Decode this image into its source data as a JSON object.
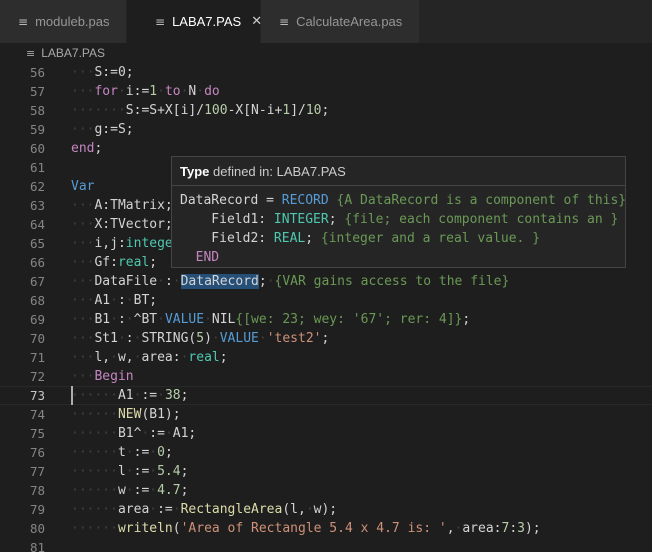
{
  "tabs": [
    {
      "label": "moduleb.pas",
      "active": false
    },
    {
      "label": "LABA7.PAS",
      "active": true
    },
    {
      "label": "CalculateArea.pas",
      "active": false
    }
  ],
  "breadcrumb": "LABA7.PAS",
  "lines": [
    {
      "n": 56,
      "segs": [
        [
          "ws",
          "···"
        ],
        [
          "",
          "S:=0;"
        ]
      ]
    },
    {
      "n": 57,
      "segs": [
        [
          "ws",
          "···"
        ],
        [
          "kw",
          "for"
        ],
        [
          "ws",
          "·"
        ],
        [
          "",
          "i:="
        ],
        [
          "nm",
          "1"
        ],
        [
          "ws",
          "·"
        ],
        [
          "kw",
          "to"
        ],
        [
          "ws",
          "·"
        ],
        [
          "",
          "N"
        ],
        [
          "ws",
          "·"
        ],
        [
          "kw",
          "do"
        ]
      ]
    },
    {
      "n": 58,
      "segs": [
        [
          "ws",
          "·······"
        ],
        [
          "",
          "S:=S+X[i]/"
        ],
        [
          "nm",
          "100"
        ],
        [
          "",
          "-X[N-i+"
        ],
        [
          "nm",
          "1"
        ],
        [
          "",
          "]/"
        ],
        [
          "nm",
          "10"
        ],
        [
          "",
          ";"
        ]
      ]
    },
    {
      "n": 59,
      "segs": [
        [
          "ws",
          "···"
        ],
        [
          "",
          "g:=S;"
        ]
      ]
    },
    {
      "n": 60,
      "segs": [
        [
          "kw",
          "end"
        ],
        [
          "",
          ";"
        ]
      ]
    },
    {
      "n": 61,
      "segs": []
    },
    {
      "n": 62,
      "segs": [
        [
          "kb",
          "Var"
        ]
      ]
    },
    {
      "n": 63,
      "segs": [
        [
          "ws",
          "···"
        ],
        [
          "",
          "A:TMatrix;"
        ]
      ]
    },
    {
      "n": 64,
      "segs": [
        [
          "ws",
          "···"
        ],
        [
          "",
          "X:TVector;"
        ]
      ]
    },
    {
      "n": 65,
      "segs": [
        [
          "ws",
          "···"
        ],
        [
          "",
          "i,j:"
        ],
        [
          "tp",
          "integer"
        ]
      ]
    },
    {
      "n": 66,
      "segs": [
        [
          "ws",
          "···"
        ],
        [
          "",
          "Gf:"
        ],
        [
          "tp",
          "real"
        ],
        [
          "",
          ";"
        ]
      ]
    },
    {
      "n": 67,
      "segs": [
        [
          "ws",
          "···"
        ],
        [
          "",
          "DataFile"
        ],
        [
          "ws",
          "·"
        ],
        [
          "",
          ":"
        ],
        [
          "ws",
          "·"
        ],
        [
          "hl",
          "DataRecord"
        ],
        [
          "",
          ";"
        ],
        [
          "ws",
          "·"
        ],
        [
          "cm",
          "{VAR gains access to the file}"
        ]
      ]
    },
    {
      "n": 68,
      "segs": [
        [
          "ws",
          "···"
        ],
        [
          "",
          "A1"
        ],
        [
          "ws",
          "·"
        ],
        [
          "",
          ":"
        ],
        [
          "ws",
          "·"
        ],
        [
          "",
          "BT;"
        ]
      ]
    },
    {
      "n": 69,
      "segs": [
        [
          "ws",
          "···"
        ],
        [
          "",
          "B1"
        ],
        [
          "ws",
          "·"
        ],
        [
          "",
          ":"
        ],
        [
          "ws",
          "·"
        ],
        [
          "",
          "^BT"
        ],
        [
          "ws",
          "·"
        ],
        [
          "kb",
          "VALUE"
        ],
        [
          "ws",
          "·"
        ],
        [
          "",
          "NIL"
        ],
        [
          "cm",
          "{[we: 23; wey: '67'; rer: 4]}"
        ],
        [
          "",
          ";"
        ]
      ]
    },
    {
      "n": 70,
      "segs": [
        [
          "ws",
          "···"
        ],
        [
          "",
          "St1"
        ],
        [
          "ws",
          "·"
        ],
        [
          "",
          ":"
        ],
        [
          "ws",
          "·"
        ],
        [
          "",
          "STRING("
        ],
        [
          "nm",
          "5"
        ],
        [
          "",
          ")"
        ],
        [
          "ws",
          "·"
        ],
        [
          "kb",
          "VALUE"
        ],
        [
          "ws",
          "·"
        ],
        [
          "st",
          "'test2'"
        ],
        [
          "",
          ";"
        ]
      ]
    },
    {
      "n": 71,
      "segs": [
        [
          "ws",
          "···"
        ],
        [
          "",
          "l,"
        ],
        [
          "ws",
          "·"
        ],
        [
          "",
          "w,"
        ],
        [
          "ws",
          "·"
        ],
        [
          "",
          "area:"
        ],
        [
          "ws",
          "·"
        ],
        [
          "tp",
          "real"
        ],
        [
          "",
          ";"
        ]
      ]
    },
    {
      "n": 72,
      "segs": [
        [
          "ws",
          "···"
        ],
        [
          "kw",
          "Begin"
        ]
      ]
    },
    {
      "n": 73,
      "segs": [
        [
          "ws",
          "······"
        ],
        [
          "",
          "A1"
        ],
        [
          "ws",
          "·"
        ],
        [
          "",
          ":="
        ],
        [
          "ws",
          "·"
        ],
        [
          "nm",
          "38"
        ],
        [
          "",
          ";"
        ]
      ],
      "current": true
    },
    {
      "n": 74,
      "segs": [
        [
          "ws",
          "······"
        ],
        [
          "fn",
          "NEW"
        ],
        [
          "",
          "(B1);"
        ]
      ]
    },
    {
      "n": 75,
      "segs": [
        [
          "ws",
          "······"
        ],
        [
          "",
          "B1^"
        ],
        [
          "ws",
          "·"
        ],
        [
          "",
          ":="
        ],
        [
          "ws",
          "·"
        ],
        [
          "",
          "A1;"
        ]
      ]
    },
    {
      "n": 76,
      "segs": [
        [
          "ws",
          "······"
        ],
        [
          "",
          "t"
        ],
        [
          "ws",
          "·"
        ],
        [
          "",
          ":="
        ],
        [
          "ws",
          "·"
        ],
        [
          "nm",
          "0"
        ],
        [
          "",
          ";"
        ]
      ]
    },
    {
      "n": 77,
      "segs": [
        [
          "ws",
          "······"
        ],
        [
          "",
          "l"
        ],
        [
          "ws",
          "·"
        ],
        [
          "",
          ":="
        ],
        [
          "ws",
          "·"
        ],
        [
          "nm",
          "5.4"
        ],
        [
          "",
          ";"
        ]
      ]
    },
    {
      "n": 78,
      "segs": [
        [
          "ws",
          "······"
        ],
        [
          "",
          "w"
        ],
        [
          "ws",
          "·"
        ],
        [
          "",
          ":="
        ],
        [
          "ws",
          "·"
        ],
        [
          "nm",
          "4.7"
        ],
        [
          "",
          ";"
        ]
      ]
    },
    {
      "n": 79,
      "segs": [
        [
          "ws",
          "······"
        ],
        [
          "",
          "area"
        ],
        [
          "ws",
          "·"
        ],
        [
          "",
          ":="
        ],
        [
          "ws",
          "·"
        ],
        [
          "fn",
          "RectangleArea"
        ],
        [
          "",
          "(l,"
        ],
        [
          "ws",
          "·"
        ],
        [
          "",
          "w);"
        ]
      ]
    },
    {
      "n": 80,
      "segs": [
        [
          "ws",
          "······"
        ],
        [
          "fn",
          "writeln"
        ],
        [
          "",
          "("
        ],
        [
          "st",
          "'Area of Rectangle 5.4 x 4.7 is: '"
        ],
        [
          "",
          ","
        ],
        [
          "ws",
          "·"
        ],
        [
          "",
          "area:"
        ],
        [
          "nm",
          "7"
        ],
        [
          "",
          ":"
        ],
        [
          "nm",
          "3"
        ],
        [
          "",
          ");"
        ]
      ]
    },
    {
      "n": 81,
      "segs": []
    }
  ],
  "hover": {
    "title_bold": "Type",
    "title_rest": " defined in: LABA7.PAS",
    "lines": [
      [
        [
          "",
          "DataRecord = "
        ],
        [
          "kb",
          "RECORD"
        ],
        [
          "cm",
          " {A DataRecord is a component of this}"
        ]
      ],
      [
        [
          "",
          "    Field1: "
        ],
        [
          "tp",
          "INTEGER"
        ],
        [
          "",
          ";"
        ],
        [
          "cm",
          " {file; each component contains an }"
        ]
      ],
      [
        [
          "",
          "    Field2: "
        ],
        [
          "tp",
          "REAL"
        ],
        [
          "",
          ";"
        ],
        [
          "cm",
          " {integer and a real value. }"
        ]
      ],
      [
        [
          "kw",
          "  END"
        ]
      ]
    ]
  },
  "icons": {
    "file": "file-text-icon",
    "close": "close-icon"
  }
}
